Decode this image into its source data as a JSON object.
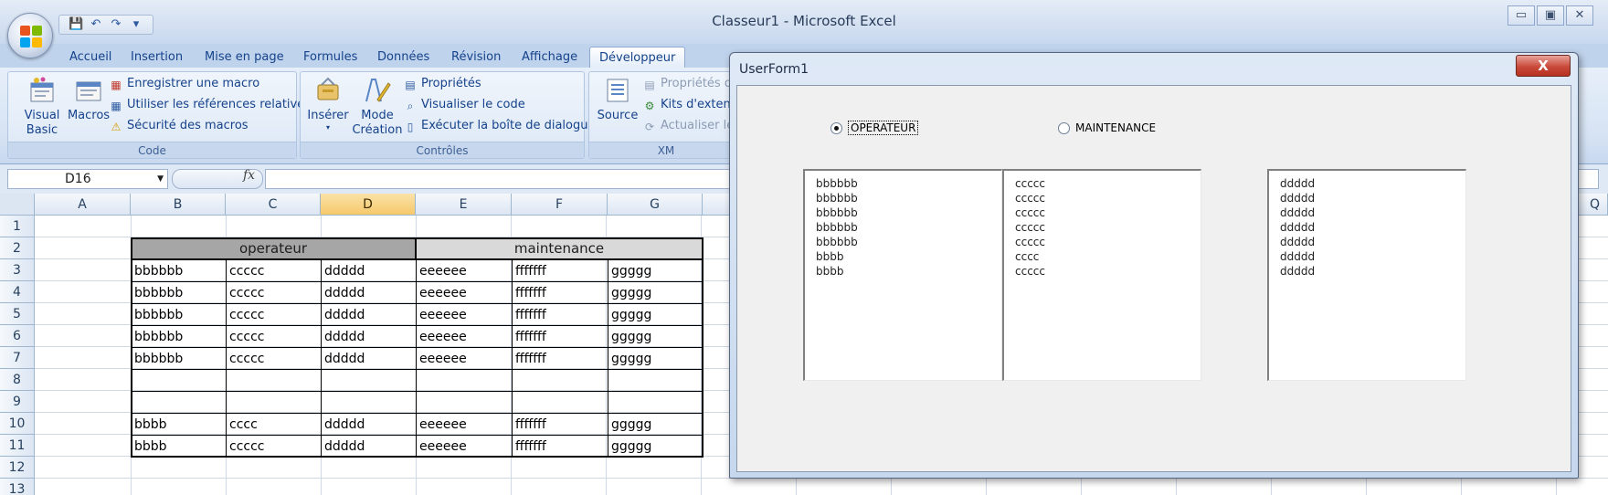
{
  "window": {
    "title": "Classeur1 - Microsoft Excel",
    "minimize": "▭",
    "restore": "▣",
    "close": "✕"
  },
  "qat": {
    "save": "💾",
    "undo": "↶",
    "redo": "↷",
    "more": "▾"
  },
  "tabs": [
    {
      "label": "Accueil"
    },
    {
      "label": "Insertion"
    },
    {
      "label": "Mise en page"
    },
    {
      "label": "Formules"
    },
    {
      "label": "Données"
    },
    {
      "label": "Révision"
    },
    {
      "label": "Affichage"
    },
    {
      "label": "Développeur"
    }
  ],
  "ribbon": {
    "code": {
      "label": "Code",
      "visual_basic": "Visual Basic",
      "macros": "Macros",
      "record_macro": "Enregistrer une macro",
      "relative_refs": "Utiliser les références relatives",
      "macro_security": "Sécurité des macros"
    },
    "controls": {
      "label": "Contrôles",
      "insert": "Insérer",
      "design_mode": "Mode Création",
      "properties": "Propriétés",
      "view_code": "Visualiser le code",
      "run_dialog": "Exécuter la boîte de dialogue"
    },
    "xml": {
      "label": "XM",
      "source": "Source",
      "map_properties": "Propriétés d",
      "expansion_packs": "Kits d'extensi",
      "refresh_data": "Actualiser les"
    }
  },
  "formula_bar": {
    "name_box": "D16",
    "fx": "fx",
    "formula": ""
  },
  "sheet": {
    "columns": [
      "A",
      "B",
      "C",
      "D",
      "E",
      "F",
      "G"
    ],
    "extra_column": "Q",
    "selected_column": "D",
    "rows": [
      "1",
      "2",
      "3",
      "4",
      "5",
      "6",
      "7",
      "8",
      "9",
      "10",
      "11",
      "12",
      "13"
    ],
    "group_headers": {
      "operateur": "operateur",
      "maintenance": "maintenance"
    },
    "data": [
      [
        "bbbbbb",
        "ccccc",
        "ddddd",
        "eeeeee",
        "fffffff",
        "ggggg"
      ],
      [
        "bbbbbb",
        "ccccc",
        "ddddd",
        "eeeeee",
        "fffffff",
        "ggggg"
      ],
      [
        "bbbbbb",
        "ccccc",
        "ddddd",
        "eeeeee",
        "fffffff",
        "ggggg"
      ],
      [
        "bbbbbb",
        "ccccc",
        "ddddd",
        "eeeeee",
        "fffffff",
        "ggggg"
      ],
      [
        "bbbbbb",
        "ccccc",
        "ddddd",
        "eeeeee",
        "fffffff",
        "ggggg"
      ],
      [
        "",
        "",
        "",
        "",
        "",
        ""
      ],
      [
        "",
        "",
        "",
        "",
        "",
        ""
      ],
      [
        "bbbb",
        "cccc",
        "ddddd",
        "eeeeee",
        "fffffff",
        "ggggg"
      ],
      [
        "bbbb",
        "ccccc",
        "ddddd",
        "eeeeee",
        "fffffff",
        "ggggg"
      ]
    ]
  },
  "userform": {
    "title": "UserForm1",
    "close": "X",
    "radio_operateur": "OPERATEUR",
    "radio_maintenance": "MAINTENANCE",
    "selected": "OPERATEUR",
    "list1": [
      "bbbbbb",
      "bbbbbb",
      "bbbbbb",
      "bbbbbb",
      "bbbbbb",
      "bbbb",
      "bbbb"
    ],
    "list2": [
      "ccccc",
      "ccccc",
      "ccccc",
      "ccccc",
      "ccccc",
      "cccc",
      "ccccc"
    ],
    "list3": [
      "ddddd",
      "ddddd",
      "ddddd",
      "ddddd",
      "ddddd",
      "ddddd",
      "ddddd"
    ]
  },
  "colors": {
    "operateur_header": "#a6a6a6",
    "maintenance_header": "#d9d9d9",
    "selected_column": "#f6c86a",
    "form_close": "#c94a3a"
  }
}
